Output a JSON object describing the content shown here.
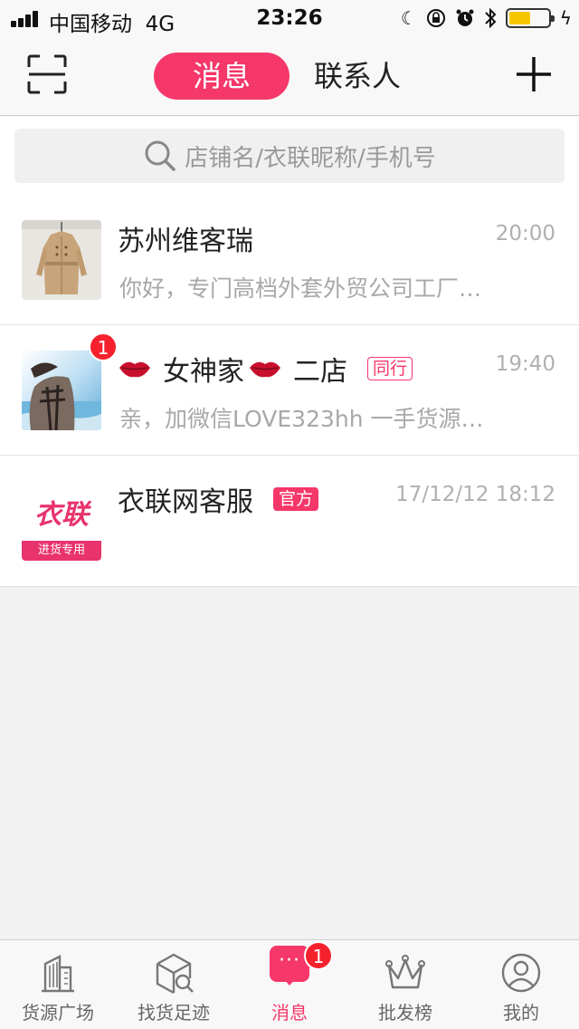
{
  "status_bar": {
    "carrier": "中国移动",
    "network": "4G",
    "time": "23:26"
  },
  "header": {
    "tab_messages": "消息",
    "tab_contacts": "联系人"
  },
  "search": {
    "placeholder": "店铺名/衣联昵称/手机号"
  },
  "conversations": [
    {
      "name": "苏州维客瑞",
      "time": "20:00",
      "preview": "你好，专门高档外套外贸公司工厂…",
      "badge": "",
      "tag": ""
    },
    {
      "name_part1": "女神家",
      "name_part2": "二店",
      "time": "19:40",
      "preview": "亲，加微信LOVE323hh  一手货源…",
      "badge": "1",
      "tag": "同行"
    },
    {
      "name": "衣联网客服",
      "time": "17/12/12 18:12",
      "preview": "",
      "badge": "",
      "tag": "官方",
      "avatar_logo": "衣联",
      "avatar_sub": "进货专用"
    }
  ],
  "tabbar": {
    "items": [
      {
        "label": "货源广场",
        "icon": "building-icon"
      },
      {
        "label": "找货足迹",
        "icon": "box-search-icon"
      },
      {
        "label": "消息",
        "icon": "chat-bubble-icon",
        "badge": "1",
        "glyph": "···"
      },
      {
        "label": "批发榜",
        "icon": "crown-icon"
      },
      {
        "label": "我的",
        "icon": "person-icon"
      }
    ]
  },
  "colors": {
    "accent": "#f5376a",
    "badge": "#f5222d",
    "battery": "#f7c600"
  }
}
